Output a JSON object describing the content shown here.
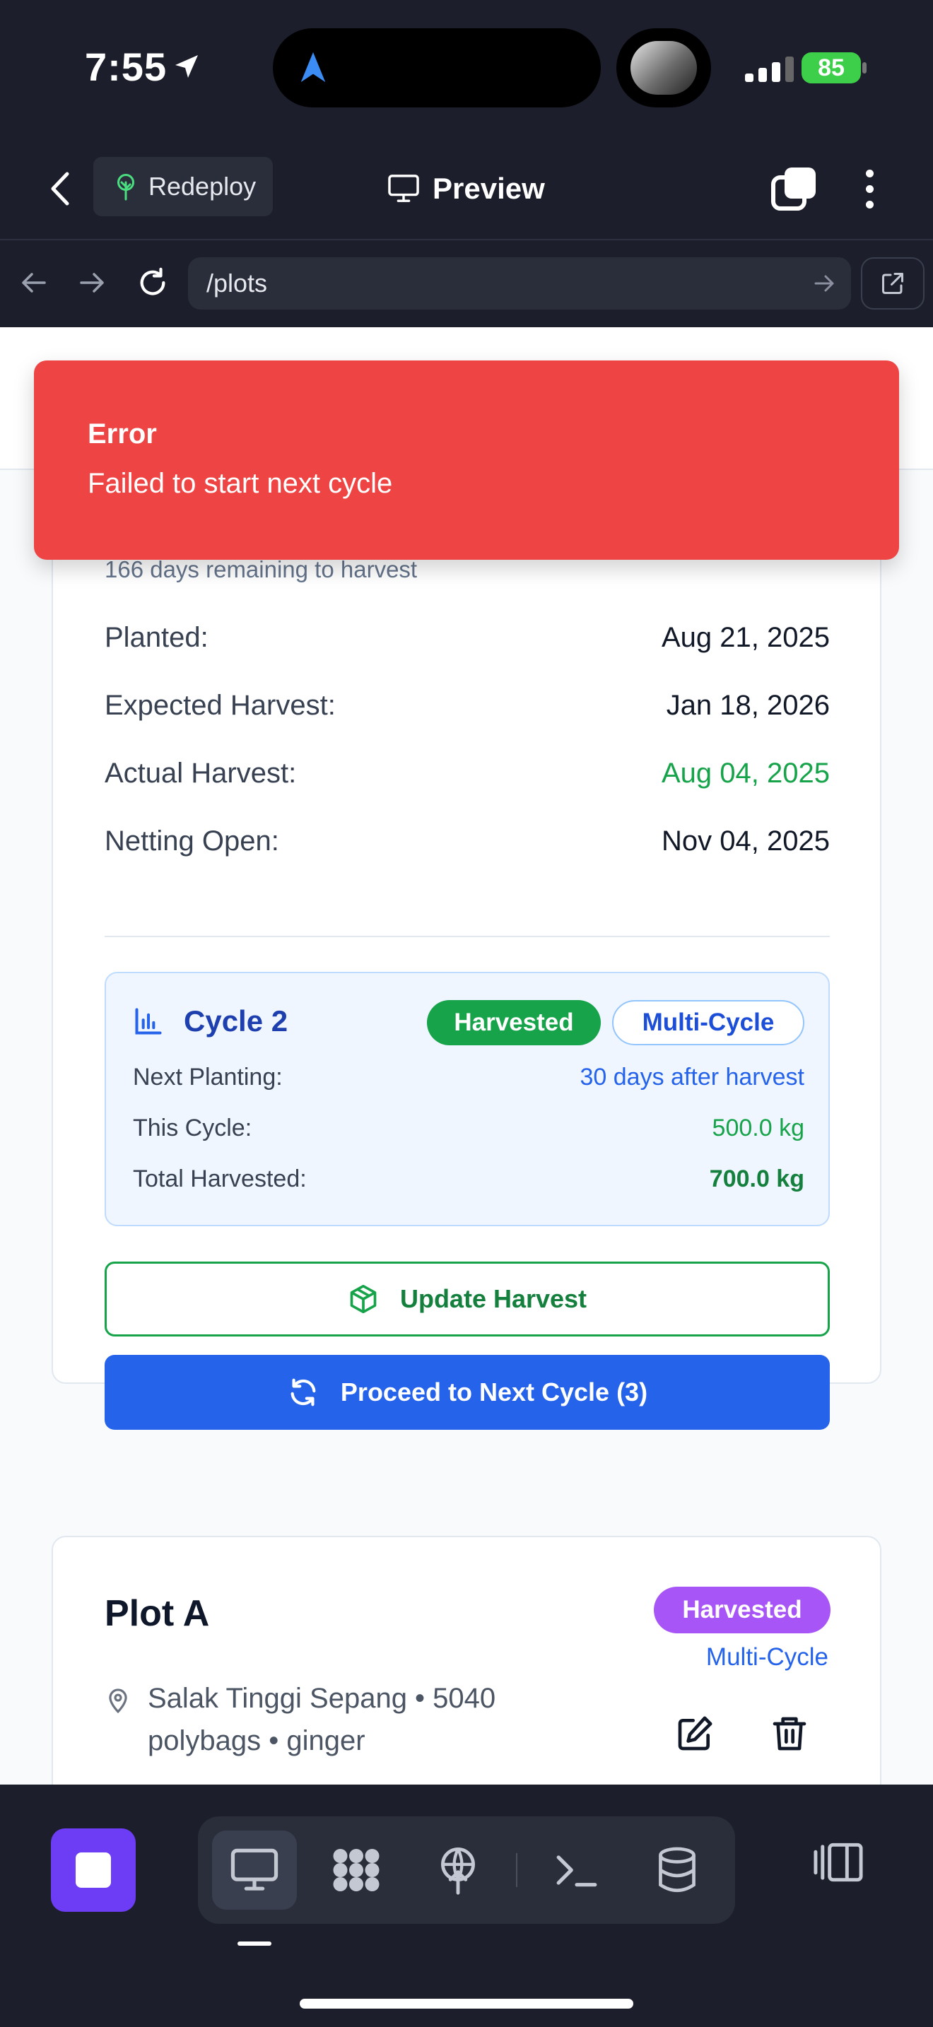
{
  "status_bar": {
    "time": "7:55",
    "battery": "85"
  },
  "header": {
    "redeploy_label": "Redeploy",
    "preview_label": "Preview"
  },
  "browser": {
    "url": "/plots"
  },
  "toast": {
    "title": "Error",
    "message": "Failed to start next cycle"
  },
  "plot_card": {
    "days_remaining": "166 days remaining to harvest",
    "rows": [
      {
        "label": "Planted:",
        "value": "Aug 21, 2025"
      },
      {
        "label": "Expected Harvest:",
        "value": "Jan 18, 2026"
      },
      {
        "label": "Actual Harvest:",
        "value": "Aug 04, 2025",
        "color": "#16a34a"
      },
      {
        "label": "Netting Open:",
        "value": "Nov 04, 2025"
      }
    ],
    "cycle": {
      "title": "Cycle 2",
      "status_badge": "Harvested",
      "type_badge": "Multi-Cycle",
      "rows": [
        {
          "label": "Next Planting:",
          "value": "30 days after harvest"
        },
        {
          "label": "This Cycle:",
          "value": "500.0 kg"
        },
        {
          "label": "Total Harvested:",
          "value": "700.0 kg"
        }
      ]
    },
    "update_button": "Update Harvest",
    "next_cycle_button": "Proceed to Next Cycle (3)"
  },
  "next_plot": {
    "title": "Plot A",
    "status_badge": "Harvested",
    "type_label": "Multi-Cycle",
    "location": "Salak Tinggi Sepang • 5040 polybags • ginger"
  },
  "colors": {
    "primary": "#2563eb",
    "success": "#16a34a",
    "error": "#ef4444",
    "purple": "#a855f7",
    "dark_bg": "#1c1f2b"
  },
  "icons": [
    "location-arrow-icon",
    "navigation-icon",
    "signal-icon",
    "back-chevron-icon",
    "tree-icon",
    "monitor-icon",
    "tabs-icon",
    "more-vertical-icon",
    "arrow-left-icon",
    "arrow-right-icon",
    "refresh-icon",
    "external-link-icon",
    "bar-chart-icon",
    "package-icon",
    "cycle-icon",
    "map-pin-icon",
    "edit-icon",
    "trash-icon",
    "stop-icon",
    "layers-icon",
    "deploy-icon",
    "terminal-icon",
    "database-icon",
    "panel-icon"
  ]
}
